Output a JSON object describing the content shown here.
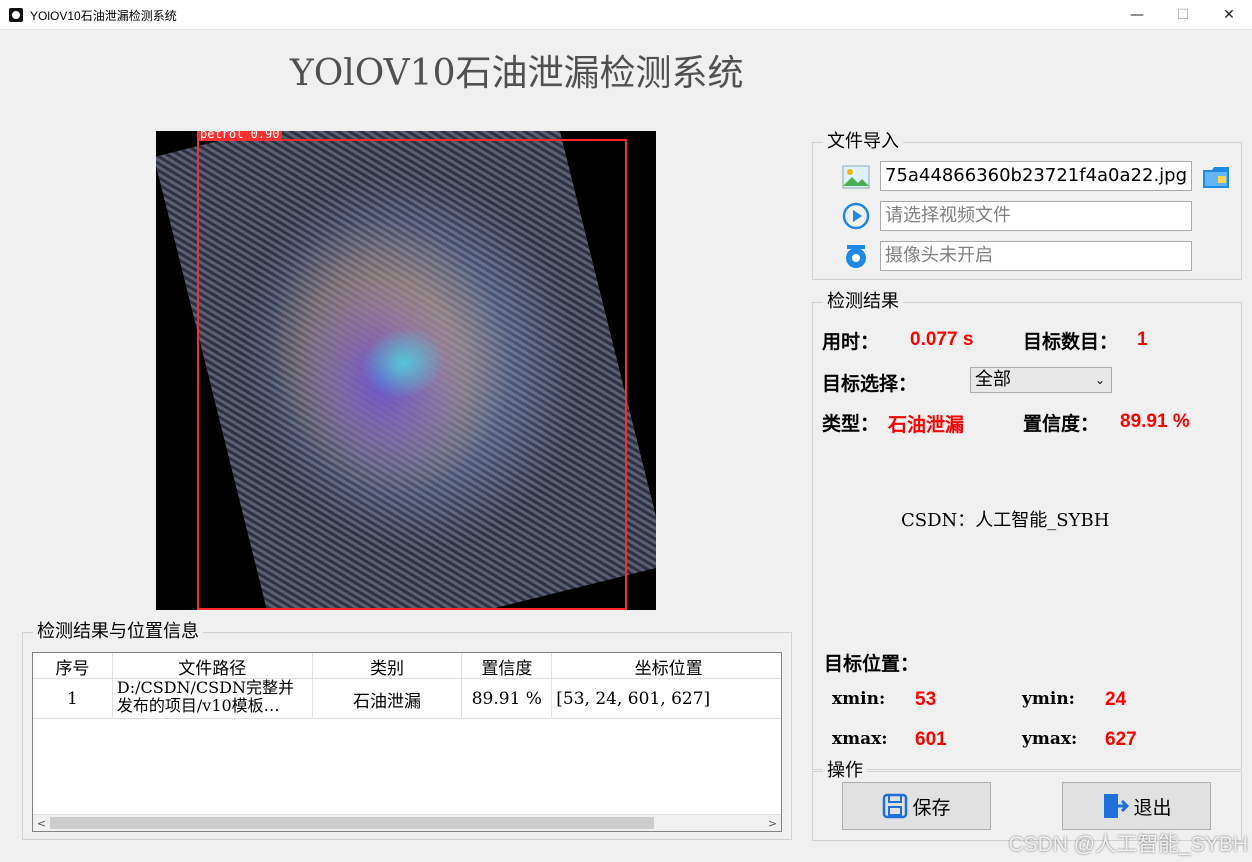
{
  "window": {
    "title": "YOlOV10石油泄漏检测系统",
    "minimize": "—",
    "maximize": "☐",
    "close": "✕"
  },
  "main_title": "YOlOV10石油泄漏检测系统",
  "image_view": {
    "detection_label": "petrol 0.90"
  },
  "file_import": {
    "title": "文件导入",
    "image_field": "75a44866360b23721f4a0a22.jpg",
    "video_placeholder": "请选择视频文件",
    "camera_placeholder": "摄像头未开启",
    "icons": {
      "image": "image-icon",
      "video": "play-icon",
      "camera": "camera-icon",
      "folder": "folder-icon"
    }
  },
  "detection_result": {
    "title": "检测结果",
    "time_label": "用时：",
    "time_value": "0.077 s",
    "count_label": "目标数目：",
    "count_value": "1",
    "select_label": "目标选择：",
    "select_value": "全部",
    "type_label": "类型：",
    "type_value": "石油泄漏",
    "conf_label": "置信度：",
    "conf_value": "89.91 %",
    "credit": "CSDN：人工智能_SYBH",
    "position_label": "目标位置：",
    "xmin_label": "xmin:",
    "xmin_value": "53",
    "ymin_label": "ymin:",
    "ymin_value": "24",
    "xmax_label": "xmax:",
    "xmax_value": "601",
    "ymax_label": "ymax:",
    "ymax_value": "627"
  },
  "operations": {
    "title": "操作",
    "save_label": "保存",
    "exit_label": "退出"
  },
  "results_table": {
    "title": "检测结果与位置信息",
    "headers": [
      "序号",
      "文件路径",
      "类别",
      "置信度",
      "坐标位置"
    ],
    "rows": [
      {
        "index": "1",
        "path_line1": "D:/CSDN/CSDN完整并",
        "path_line2": "发布的项目/v10模板…",
        "category": "石油泄漏",
        "confidence": "89.91 %",
        "coords": "[53, 24, 601, 627]"
      }
    ]
  },
  "watermark": "CSDN @人工智能_SYBH",
  "colors": {
    "accent_red": "#ff0000",
    "bbox_red": "#ff2a2a"
  }
}
